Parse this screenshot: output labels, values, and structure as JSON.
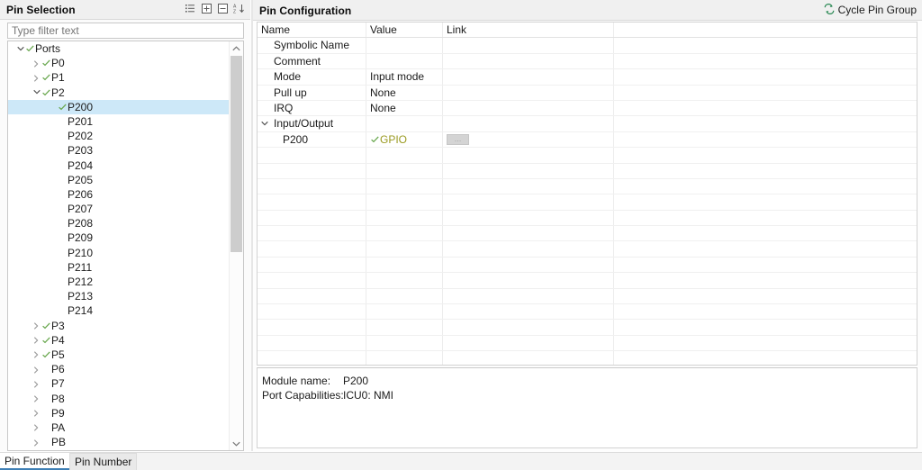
{
  "pin_selection": {
    "title": "Pin Selection",
    "tools": [
      {
        "name": "collapse-tree-icon",
        "glyph": "list"
      },
      {
        "name": "expand-all-icon",
        "glyph": "plus-box"
      },
      {
        "name": "collapse-all-icon",
        "glyph": "minus-box"
      },
      {
        "name": "sort-icon",
        "glyph": "sort-az"
      }
    ],
    "filter": {
      "value": "",
      "placeholder": "Type filter text"
    },
    "tree": [
      {
        "label": "Ports",
        "depth": 0,
        "chevron": "down",
        "check": true,
        "selected": false
      },
      {
        "label": "P0",
        "depth": 1,
        "chevron": "right",
        "check": true,
        "selected": false
      },
      {
        "label": "P1",
        "depth": 1,
        "chevron": "right",
        "check": true,
        "selected": false
      },
      {
        "label": "P2",
        "depth": 1,
        "chevron": "down",
        "check": true,
        "selected": false
      },
      {
        "label": "P200",
        "depth": 2,
        "chevron": "none",
        "check": true,
        "selected": true
      },
      {
        "label": "P201",
        "depth": 2,
        "chevron": "none",
        "check": false,
        "selected": false
      },
      {
        "label": "P202",
        "depth": 2,
        "chevron": "none",
        "check": false,
        "selected": false
      },
      {
        "label": "P203",
        "depth": 2,
        "chevron": "none",
        "check": false,
        "selected": false
      },
      {
        "label": "P204",
        "depth": 2,
        "chevron": "none",
        "check": false,
        "selected": false
      },
      {
        "label": "P205",
        "depth": 2,
        "chevron": "none",
        "check": false,
        "selected": false
      },
      {
        "label": "P206",
        "depth": 2,
        "chevron": "none",
        "check": false,
        "selected": false
      },
      {
        "label": "P207",
        "depth": 2,
        "chevron": "none",
        "check": false,
        "selected": false
      },
      {
        "label": "P208",
        "depth": 2,
        "chevron": "none",
        "check": false,
        "selected": false
      },
      {
        "label": "P209",
        "depth": 2,
        "chevron": "none",
        "check": false,
        "selected": false
      },
      {
        "label": "P210",
        "depth": 2,
        "chevron": "none",
        "check": false,
        "selected": false
      },
      {
        "label": "P211",
        "depth": 2,
        "chevron": "none",
        "check": false,
        "selected": false
      },
      {
        "label": "P212",
        "depth": 2,
        "chevron": "none",
        "check": false,
        "selected": false
      },
      {
        "label": "P213",
        "depth": 2,
        "chevron": "none",
        "check": false,
        "selected": false
      },
      {
        "label": "P214",
        "depth": 2,
        "chevron": "none",
        "check": false,
        "selected": false
      },
      {
        "label": "P3",
        "depth": 1,
        "chevron": "right",
        "check": true,
        "selected": false
      },
      {
        "label": "P4",
        "depth": 1,
        "chevron": "right",
        "check": true,
        "selected": false
      },
      {
        "label": "P5",
        "depth": 1,
        "chevron": "right",
        "check": true,
        "selected": false
      },
      {
        "label": "P6",
        "depth": 1,
        "chevron": "right",
        "check": false,
        "selected": false
      },
      {
        "label": "P7",
        "depth": 1,
        "chevron": "right",
        "check": false,
        "selected": false
      },
      {
        "label": "P8",
        "depth": 1,
        "chevron": "right",
        "check": false,
        "selected": false
      },
      {
        "label": "P9",
        "depth": 1,
        "chevron": "right",
        "check": false,
        "selected": false
      },
      {
        "label": "PA",
        "depth": 1,
        "chevron": "right",
        "check": false,
        "selected": false
      },
      {
        "label": "PB",
        "depth": 1,
        "chevron": "right",
        "check": false,
        "selected": false
      }
    ]
  },
  "pin_configuration": {
    "title": "Pin Configuration",
    "cycle_button": {
      "label": "Cycle Pin Group",
      "icon": "cycle-icon"
    },
    "columns": [
      "Name",
      "Value",
      "Link"
    ],
    "rows": [
      {
        "name": "Symbolic Name",
        "value": "",
        "indent": 1,
        "chevron": "none",
        "link": false,
        "value_style": "plain"
      },
      {
        "name": "Comment",
        "value": "",
        "indent": 1,
        "chevron": "none",
        "link": false,
        "value_style": "plain"
      },
      {
        "name": "Mode",
        "value": "Input mode",
        "indent": 1,
        "chevron": "none",
        "link": false,
        "value_style": "plain"
      },
      {
        "name": "Pull up",
        "value": "None",
        "indent": 1,
        "chevron": "none",
        "link": false,
        "value_style": "plain"
      },
      {
        "name": "IRQ",
        "value": "None",
        "indent": 1,
        "chevron": "none",
        "link": false,
        "value_style": "plain"
      },
      {
        "name": "Input/Output",
        "value": "",
        "indent": 0,
        "chevron": "down",
        "link": false,
        "value_style": "plain"
      },
      {
        "name": "P200",
        "value": "GPIO",
        "indent": 2,
        "chevron": "none",
        "link": true,
        "value_style": "gpio"
      }
    ],
    "empty_row_count": 17,
    "info": {
      "module_name_label": "Module name:",
      "module_name_value": "P200",
      "port_capabilities_label": "Port Capabilities:",
      "port_capabilities_value": "ICU0: NMI"
    }
  },
  "tabs": [
    {
      "label": "Pin Function",
      "active": true
    },
    {
      "label": "Pin Number",
      "active": false
    }
  ],
  "colors": {
    "selection_blue": "#cde8f8",
    "check_green": "#6aa84f",
    "gpio_olive": "#9a9a20",
    "tab_underline": "#3e7fb5",
    "cycle_icon": "#2e8b57"
  }
}
